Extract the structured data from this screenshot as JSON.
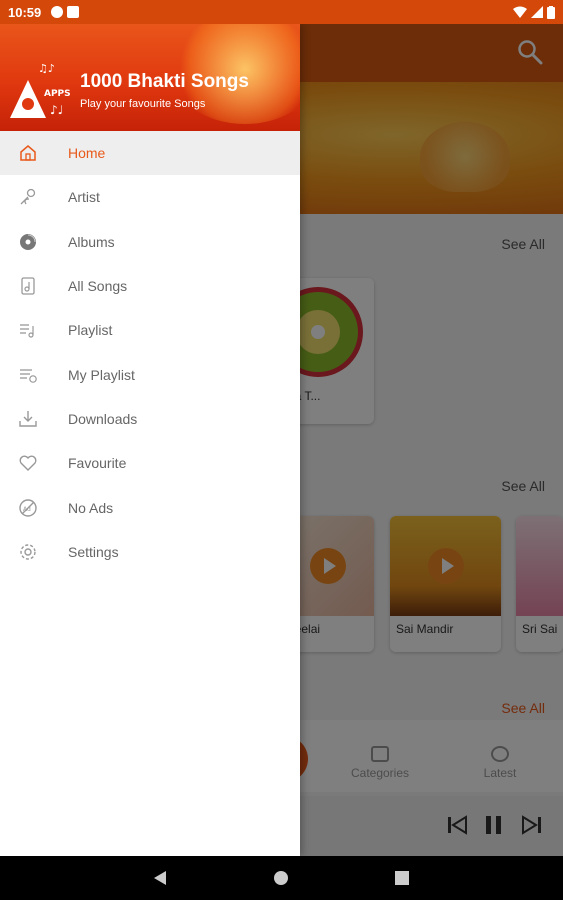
{
  "status_bar": {
    "time": "10:59"
  },
  "drawer": {
    "app_name": "1000 Bhakti Songs",
    "app_subtitle": "Play your favourite Songs",
    "logo_text": "APPS",
    "items": [
      {
        "label": "Home",
        "icon": "home-icon",
        "active": true
      },
      {
        "label": "Artist",
        "icon": "artist-icon",
        "active": false
      },
      {
        "label": "Albums",
        "icon": "album-disc-icon",
        "active": false
      },
      {
        "label": "All Songs",
        "icon": "song-list-icon",
        "active": false
      },
      {
        "label": "Playlist",
        "icon": "playlist-icon",
        "active": false
      },
      {
        "label": "My Playlist",
        "icon": "my-playlist-icon",
        "active": false
      },
      {
        "label": "Downloads",
        "icon": "download-icon",
        "active": false
      },
      {
        "label": "Favourite",
        "icon": "heart-icon",
        "active": false
      },
      {
        "label": "No Ads",
        "icon": "no-ads-icon",
        "active": false
      },
      {
        "label": "Settings",
        "icon": "gear-icon",
        "active": false
      }
    ]
  },
  "background": {
    "see_all_1": "See All",
    "see_all_2": "See All",
    "see_all_3": "See All",
    "card_top_label": "na T...",
    "cards": [
      {
        "label": "Leelai"
      },
      {
        "label": "Sai Mandir"
      },
      {
        "label": "Sri Sai"
      }
    ],
    "tabs": [
      {
        "label": "Categories"
      },
      {
        "label": "Latest"
      }
    ]
  },
  "colors": {
    "accent": "#e8591a",
    "status_bar": "#d4480a",
    "drawer_header": "#e0380f"
  }
}
